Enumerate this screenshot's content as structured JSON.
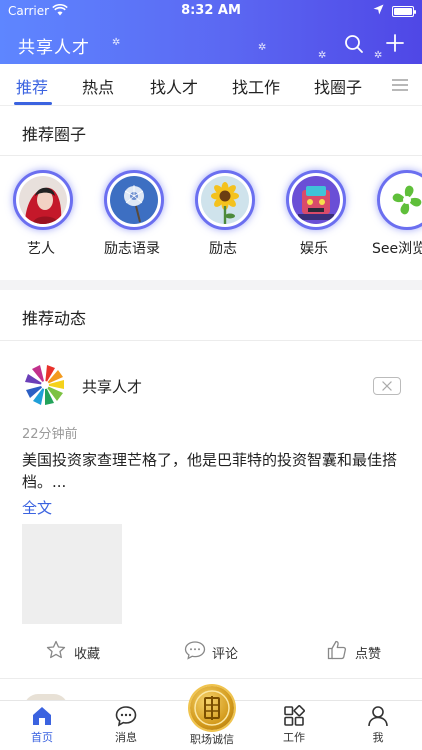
{
  "status": {
    "carrier": "Carrier",
    "time": "8:32 AM"
  },
  "header": {
    "title": "共享人才",
    "search_icon": "search-icon",
    "add_icon": "plus-icon"
  },
  "tabs": [
    {
      "label": "推荐",
      "active": true
    },
    {
      "label": "热点"
    },
    {
      "label": "找人才"
    },
    {
      "label": "找工作"
    },
    {
      "label": "找圈子"
    }
  ],
  "circles_section": {
    "title": "推荐圈子",
    "items": [
      {
        "label": "艺人",
        "icon": "artist-photo"
      },
      {
        "label": "励志语录",
        "icon": "dandelion-photo"
      },
      {
        "label": "励志",
        "icon": "sunflower-photo"
      },
      {
        "label": "娱乐",
        "icon": "entertainment-photo"
      },
      {
        "label": "See浏览",
        "icon": "green-flower-logo"
      }
    ]
  },
  "feed_section": {
    "title": "推荐动态"
  },
  "post": {
    "author": "共享人才",
    "time": "22分钟前",
    "text": "美国投资家查理芒格了，他是巴菲特的投资智囊和最佳搭档。...",
    "more": "全文",
    "actions": {
      "favorite": "收藏",
      "comment": "评论",
      "like": "点赞"
    }
  },
  "tabbar": {
    "home": "首页",
    "messages": "消息",
    "center": "职场诚信",
    "work": "工作",
    "me": "我"
  },
  "colors": {
    "accent": "#3b63e0",
    "header_start": "#5e86ff",
    "header_end": "#4f47e6"
  }
}
